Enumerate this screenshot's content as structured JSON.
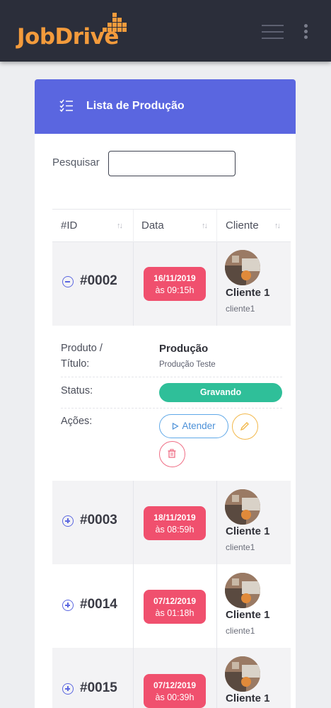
{
  "app": {
    "logo_text": "JobDrive"
  },
  "card": {
    "title": "Lista de Produção",
    "search_label": "Pesquisar",
    "search_value": ""
  },
  "table": {
    "headers": [
      "#ID",
      "Data",
      "Cliente"
    ],
    "rows": [
      {
        "id": "#0002",
        "date": "16/11/2019",
        "time": "às 09:15h",
        "client_name": "Cliente 1",
        "client_user": "cliente1",
        "expanded": true
      },
      {
        "id": "#0003",
        "date": "18/11/2019",
        "time": "às 08:59h",
        "client_name": "Cliente 1",
        "client_user": "cliente1",
        "expanded": false
      },
      {
        "id": "#0014",
        "date": "07/12/2019",
        "time": "às 01:18h",
        "client_name": "Cliente 1",
        "client_user": "cliente1",
        "expanded": false
      },
      {
        "id": "#0015",
        "date": "07/12/2019",
        "time": "às 00:39h",
        "client_name": "Cliente 1",
        "client_user": "cliente1",
        "expanded": false
      }
    ]
  },
  "detail": {
    "product_label_line1": "Produto /",
    "product_label_line2": "Título:",
    "product_value": "Produção",
    "product_subvalue": "Produção Teste",
    "status_label": "Status:",
    "status_value": "Gravando",
    "actions_label": "Ações:",
    "attend_label": "Atender"
  },
  "colors": {
    "header_bg": "#2b2e3a",
    "logo": "#f39b3c",
    "card_header": "#5a66e0",
    "date_badge": "#f0506e",
    "status_recording": "#2fbf99",
    "attend_button": "#4b90d8",
    "edit_button": "#f2b84b",
    "delete_button": "#ef6e85"
  },
  "icons": {
    "menu": "hamburger-icon",
    "more": "kebab-icon",
    "list": "list-check-icon",
    "sort": "sort-icon",
    "expand": "plus-circle-icon",
    "collapse": "minus-circle-icon",
    "play": "play-icon",
    "edit": "pencil-icon",
    "delete": "trash-icon"
  }
}
